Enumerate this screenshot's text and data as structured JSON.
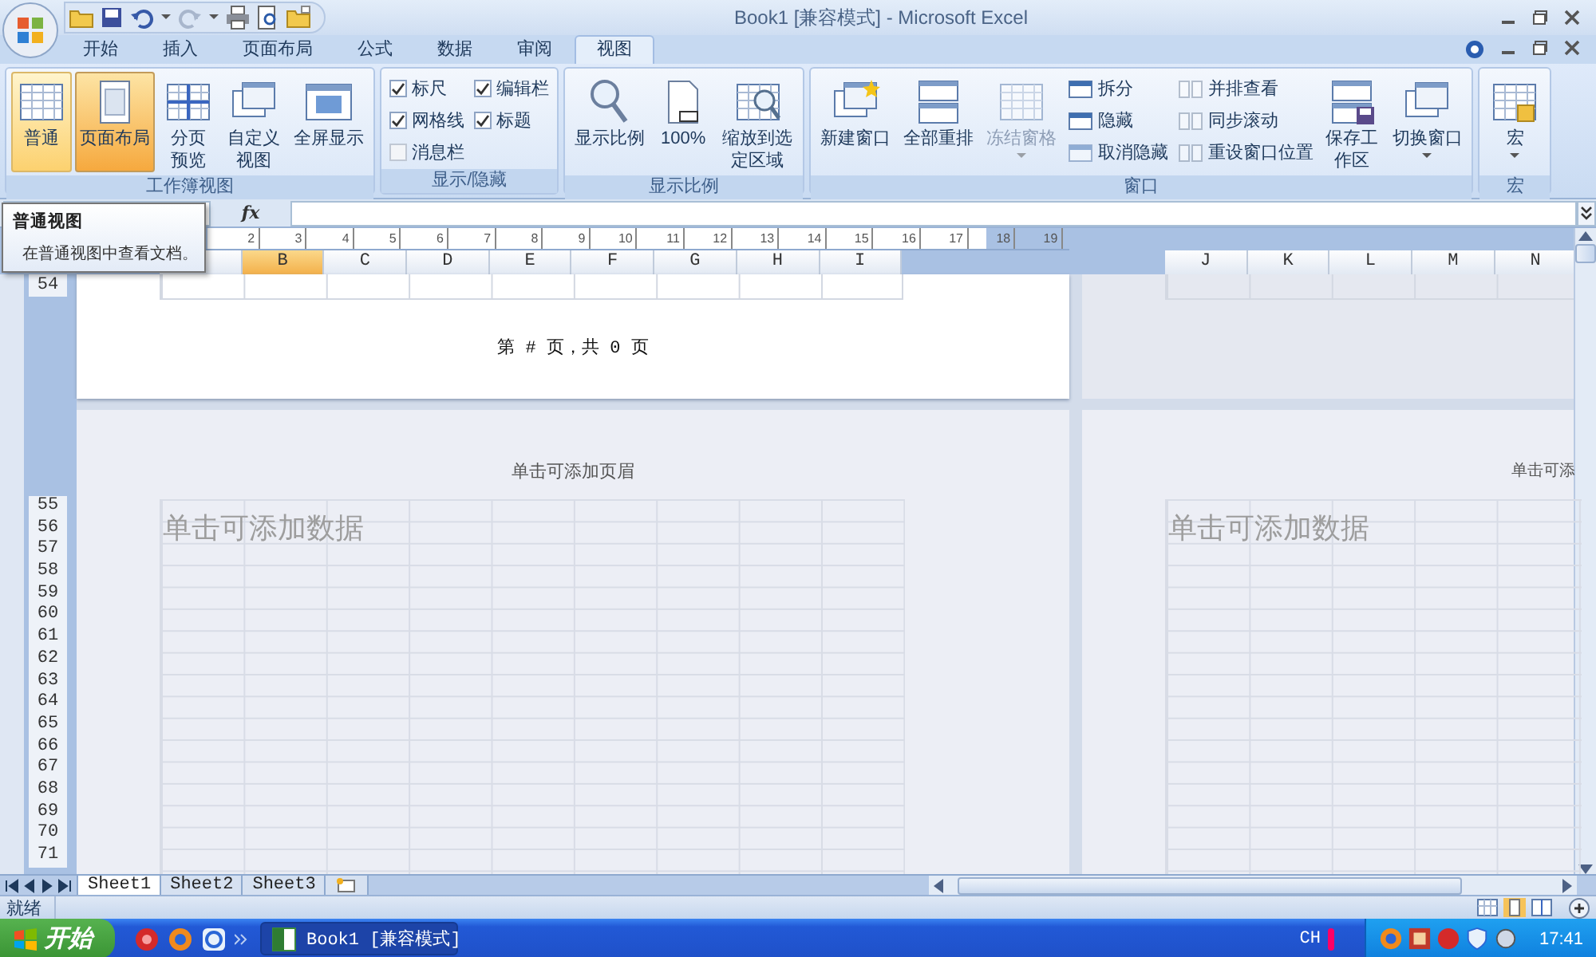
{
  "window": {
    "title": "Book1  [兼容模式] - Microsoft Excel"
  },
  "tabs": [
    {
      "label": "开始",
      "selected": false
    },
    {
      "label": "插入",
      "selected": false
    },
    {
      "label": "页面布局",
      "selected": false
    },
    {
      "label": "公式",
      "selected": false
    },
    {
      "label": "数据",
      "selected": false
    },
    {
      "label": "审阅",
      "selected": false
    },
    {
      "label": "视图",
      "selected": true
    }
  ],
  "ribbon": {
    "groups": [
      {
        "title": "工作簿视图",
        "columns": [
          [
            {
              "kind": "large",
              "label": "普通",
              "selected": false,
              "hovered": true
            }
          ],
          [
            {
              "kind": "large",
              "label": "页面布局",
              "selected": true,
              "hovered": false
            }
          ],
          [
            {
              "kind": "large",
              "label": "分页预览",
              "selected": false,
              "hovered": false
            }
          ],
          [
            {
              "kind": "large",
              "label": "自定义视图",
              "selected": false,
              "hovered": false
            }
          ],
          [
            {
              "kind": "large",
              "label": "全屏显示",
              "selected": false,
              "hovered": false
            }
          ]
        ]
      },
      {
        "title": "显示/隐藏",
        "columns": [
          [
            {
              "kind": "check",
              "label": "标尺",
              "checked": true,
              "disabled": false
            },
            {
              "kind": "check",
              "label": "网格线",
              "checked": true,
              "disabled": false
            },
            {
              "kind": "check",
              "label": "消息栏",
              "checked": false,
              "disabled": true
            }
          ],
          [
            {
              "kind": "check",
              "label": "编辑栏",
              "checked": true,
              "disabled": false
            },
            {
              "kind": "check",
              "label": "标题",
              "checked": true,
              "disabled": false
            }
          ]
        ]
      },
      {
        "title": "显示比例",
        "columns": [
          [
            {
              "kind": "large",
              "label": "显示比例"
            }
          ],
          [
            {
              "kind": "large",
              "label": "100%"
            }
          ],
          [
            {
              "kind": "large",
              "label": "缩放到选定区域"
            }
          ]
        ]
      },
      {
        "title": "窗口",
        "columns": [
          [
            {
              "kind": "large",
              "label": "新建窗口",
              "disabled": false
            }
          ],
          [
            {
              "kind": "large",
              "label": "全部重排",
              "disabled": false
            }
          ],
          [
            {
              "kind": "large",
              "label": "冻结窗格",
              "disabled": true,
              "dropdown": true
            }
          ],
          [
            {
              "kind": "small",
              "label": "拆分",
              "disabled": false
            },
            {
              "kind": "small",
              "label": "隐藏",
              "disabled": false
            },
            {
              "kind": "small",
              "label": "取消隐藏",
              "disabled": true
            }
          ],
          [
            {
              "kind": "small",
              "label": "并排查看",
              "disabled": true
            },
            {
              "kind": "small",
              "label": "同步滚动",
              "disabled": true
            },
            {
              "kind": "small",
              "label": "重设窗口位置",
              "disabled": true
            }
          ],
          [
            {
              "kind": "large",
              "label": "保存工作区",
              "disabled": false
            }
          ],
          [
            {
              "kind": "large",
              "label": "切换窗口",
              "disabled": false,
              "dropdown": true
            }
          ]
        ]
      },
      {
        "title": "宏",
        "columns": [
          [
            {
              "kind": "large",
              "label": "宏",
              "dropdown": true
            }
          ]
        ]
      }
    ]
  },
  "formula_bar": {
    "function_label": "fx"
  },
  "tooltip": {
    "title": "普通视图",
    "text": "在普通视图中查看文档。"
  },
  "sheet": {
    "ruler_marks": [
      "2",
      "3",
      "4",
      "5",
      "6",
      "7",
      "8",
      "9",
      "10",
      "11",
      "12",
      "13",
      "14",
      "15",
      "16",
      "17",
      "18",
      "19"
    ],
    "columns_left": [
      {
        "label": "B",
        "selected": true
      },
      {
        "label": "C",
        "selected": false
      },
      {
        "label": "D",
        "selected": false
      },
      {
        "label": "E",
        "selected": false
      },
      {
        "label": "F",
        "selected": false
      },
      {
        "label": "G",
        "selected": false
      },
      {
        "label": "H",
        "selected": false
      },
      {
        "label": "I",
        "selected": false
      }
    ],
    "columns_right": [
      {
        "label": "J",
        "selected": false
      },
      {
        "label": "K",
        "selected": false
      },
      {
        "label": "L",
        "selected": false
      },
      {
        "label": "M",
        "selected": false
      },
      {
        "label": "N",
        "selected": false
      }
    ],
    "top_row": "54",
    "footer": "第 # 页，共 0 页",
    "header_placeholder_left": "单击可添加页眉",
    "header_placeholder_right": "单击可添",
    "data_placeholder_left": "单击可添加数据",
    "data_placeholder_right": "单击可添加数据",
    "rows": [
      "55",
      "56",
      "57",
      "58",
      "59",
      "60",
      "61",
      "62",
      "63",
      "64",
      "65",
      "66",
      "67",
      "68",
      "69",
      "70",
      "71"
    ]
  },
  "sheet_tabs": [
    {
      "label": "Sheet1",
      "selected": true
    },
    {
      "label": "Sheet2",
      "selected": false
    },
    {
      "label": "Sheet3",
      "selected": false
    }
  ],
  "status_bar": {
    "text": "就绪"
  },
  "taskbar": {
    "start": "开始",
    "tasks": [
      {
        "label": "Book1  [兼容模式]"
      }
    ],
    "language": "CH",
    "clock": "17:41"
  }
}
